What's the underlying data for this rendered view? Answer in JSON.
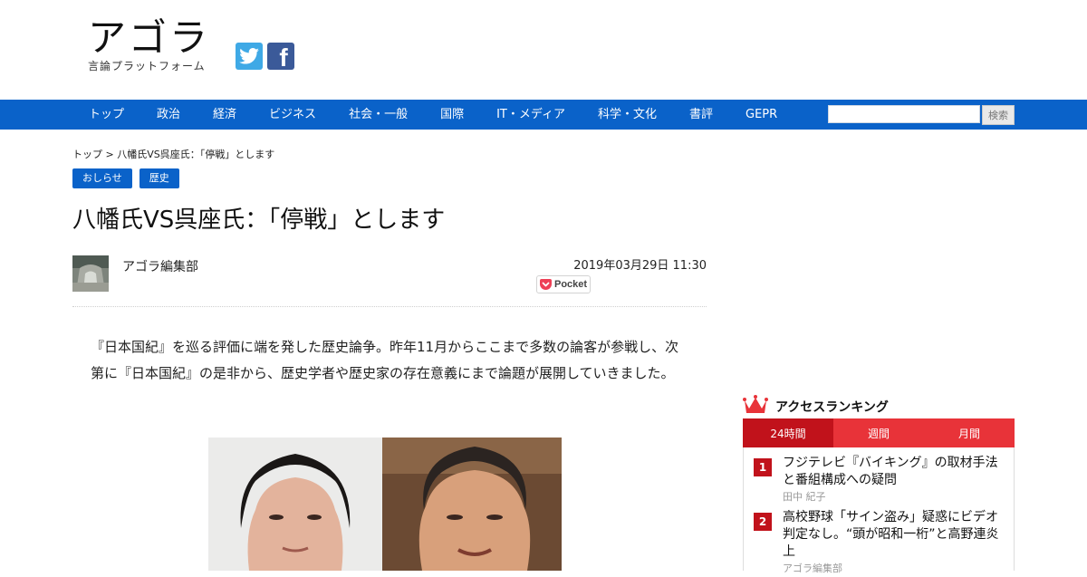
{
  "site": {
    "logo": "アゴラ",
    "tagline": "言論プラットフォーム",
    "social": [
      "twitter-icon",
      "facebook-icon"
    ]
  },
  "nav": {
    "items": [
      "トップ",
      "政治",
      "経済",
      "ビジネス",
      "社会・一般",
      "国際",
      "IT・メディア",
      "科学・文化",
      "書評",
      "GEPR"
    ],
    "search_placeholder": "",
    "search_button": "検索"
  },
  "breadcrumb": "トップ > 八幡氏VS呉座氏：「停戦」とします",
  "tags": [
    "おしらせ",
    "歴史"
  ],
  "article": {
    "title": "八幡氏VS呉座氏：「停戦」とします",
    "author": "アゴラ編集部",
    "date": "2019年03月29日 11:30",
    "pocket_label": "Pocket",
    "lead": "『日本国紀』を巡る評価に端を発した歴史論争。昨年11月からここまで多数の論客が参戦し、次第に『日本国紀』の是非から、歴史学者や歴史家の存在意義にまで論題が展開していきました。"
  },
  "ranking": {
    "title": "アクセスランキング",
    "tabs": [
      "24時間",
      "週間",
      "月間"
    ],
    "active_tab": 0,
    "items": [
      {
        "rank": "1",
        "title": "フジテレビ『バイキング』の取材手法と番組構成への疑問",
        "author": "田中 紀子"
      },
      {
        "rank": "2",
        "title": "高校野球「サイン盗み」疑惑にビデオ判定なし。“頭が昭和一桁”と高野連炎上",
        "author": "アゴラ編集部"
      }
    ]
  },
  "colors": {
    "nav_blue": "#0a62c9",
    "ranking_red": "#e83339",
    "ranking_dark_red": "#c1121b"
  }
}
